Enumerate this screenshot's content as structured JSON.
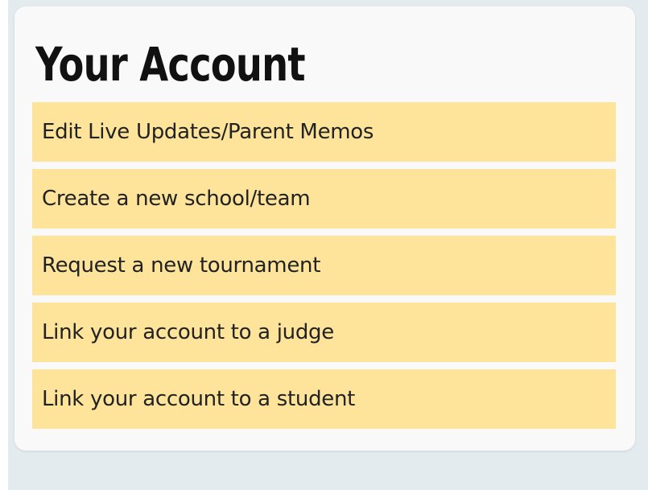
{
  "account": {
    "title": "Your Account",
    "items": [
      {
        "label": "Edit Live Updates/Parent Memos"
      },
      {
        "label": "Create a new school/team"
      },
      {
        "label": "Request a new tournament"
      },
      {
        "label": "Link your account to a judge"
      },
      {
        "label": "Link your account to a student"
      }
    ]
  },
  "colors": {
    "item_background": "#fde49a",
    "card_background": "#f9f9f9",
    "page_background": "#e4ebee"
  }
}
